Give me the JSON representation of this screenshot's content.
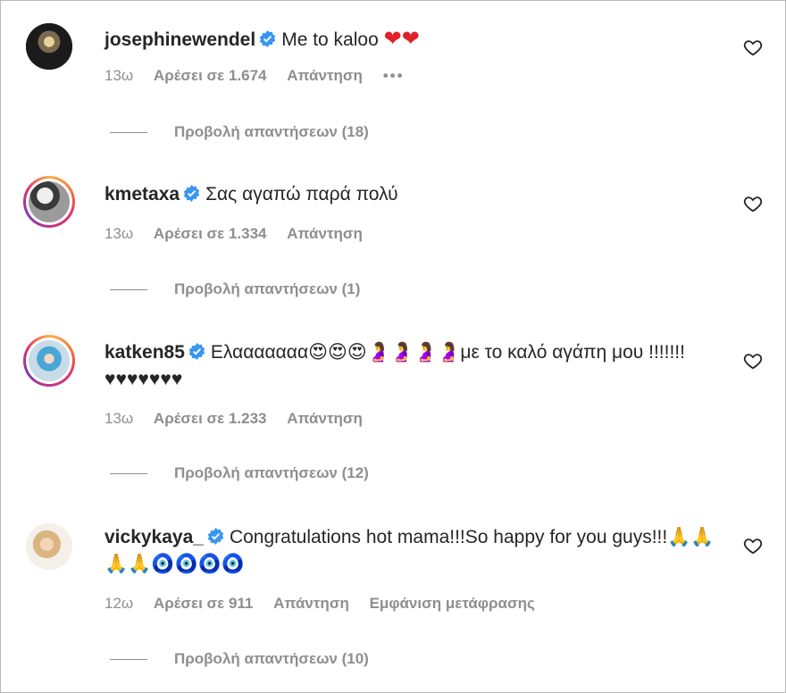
{
  "comments": [
    {
      "username": "josephinewendel",
      "text": "Me to kaloo",
      "emoji_tail": "❤❤",
      "time": "13ω",
      "likes": "Αρέσει σε 1.674",
      "reply": "Απάντηση",
      "more": "•••",
      "view_replies": "Προβολή απαντήσεων (18)"
    },
    {
      "username": "kmetaxa",
      "text": "Σας αγαπώ παρά πολύ",
      "time": "13ω",
      "likes": "Αρέσει σε 1.334",
      "reply": "Απάντηση",
      "view_replies": "Προβολή απαντήσεων (1)"
    },
    {
      "username": "katken85",
      "text": "Ελααααααα😍😍😍🤰🤰🤰🤰με το καλό αγάπη μου !!!!!!!♥♥♥♥♥♥♥",
      "time": "13ω",
      "likes": "Αρέσει σε 1.233",
      "reply": "Απάντηση",
      "view_replies": "Προβολή απαντήσεων (12)"
    },
    {
      "username": "vickykaya_",
      "text": "Congratulations hot mama!!!So happy for you guys!!!🙏🙏🙏🙏🧿🧿🧿🧿",
      "time": "12ω",
      "likes": "Αρέσει σε 911",
      "reply": "Απάντηση",
      "translate": "Εμφάνιση μετάφρασης",
      "view_replies": "Προβολή απαντήσεων (10)"
    }
  ],
  "colors": {
    "verified": "#3897f0",
    "muted": "#8e8e8e",
    "text": "#262626"
  },
  "icons": {
    "verified": "verified-badge-icon",
    "like": "heart-outline-icon"
  }
}
